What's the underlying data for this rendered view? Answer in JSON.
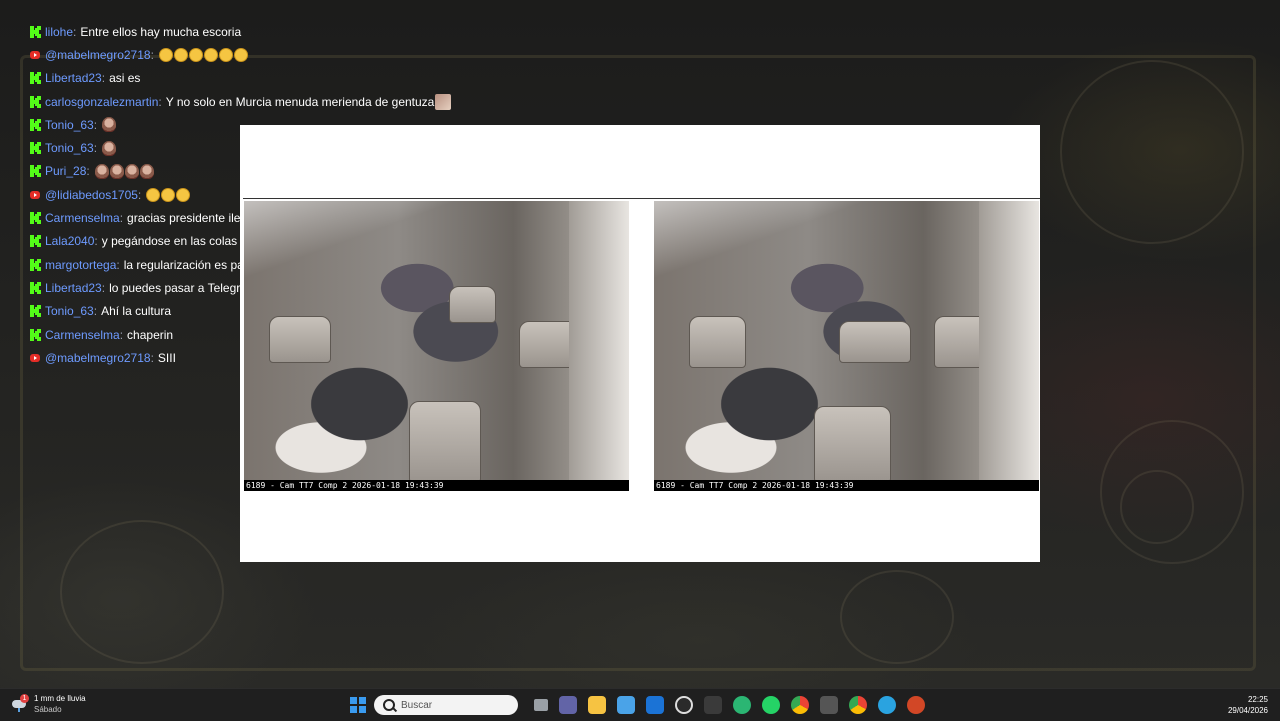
{
  "chat": [
    {
      "platform": "kick",
      "user": "lilohe",
      "text": "Entre ellos hay mucha escoria",
      "emoji": ""
    },
    {
      "platform": "youtube",
      "user": "@mabelmegro2718",
      "text": "",
      "emoji": "scream-x6"
    },
    {
      "platform": "kick",
      "user": "Libertad23",
      "text": "asi es",
      "emoji": ""
    },
    {
      "platform": "kick",
      "user": "carlosgonzalezmartin",
      "text": "Y no solo en Murcia menuda merienda de gentuza",
      "emoji": "photo"
    },
    {
      "platform": "kick",
      "user": "Tonio_63",
      "text": "",
      "emoji": "face-x1"
    },
    {
      "platform": "kick",
      "user": "Tonio_63",
      "text": "",
      "emoji": "face-x1"
    },
    {
      "platform": "kick",
      "user": "Puri_28",
      "text": "",
      "emoji": "face-x4"
    },
    {
      "platform": "youtube",
      "user": "@lidiabedos1705",
      "text": "",
      "emoji": "scream-x3"
    },
    {
      "platform": "kick",
      "user": "Carmenselma",
      "text": "gracias presidente ilegitimo y traidor",
      "emoji": ""
    },
    {
      "platform": "kick",
      "user": "Lala2040",
      "text": "y pegándose en las colas",
      "emoji": ""
    },
    {
      "platform": "kick",
      "user": "margotortega",
      "text": "la regularización es para ka ler gi. Cuando no los necesiten",
      "emoji": ""
    },
    {
      "platform": "kick",
      "user": "Libertad23",
      "text": "lo puedes pasar a Telegram Inma, el sueño de pedro",
      "emoji": ""
    },
    {
      "platform": "kick",
      "user": "Tonio_63",
      "text": "Ahí la cultura",
      "emoji": ""
    },
    {
      "platform": "kick",
      "user": "Carmenselma",
      "text": "chaperin",
      "emoji": ""
    },
    {
      "platform": "youtube",
      "user": "@mabelmegro2718",
      "text": "SIII",
      "emoji": ""
    }
  ],
  "popup": {
    "cams": [
      {
        "caption": "6189 - Cam TT7 Comp 2 2026-01-18 19:43:39"
      },
      {
        "caption": "6189 - Cam TT7 Comp 2 2026-01-18 19:43:39"
      }
    ]
  },
  "taskbar": {
    "weather_line1": "1 mm de lluvia",
    "weather_line2": "Sábado",
    "weather_alert": "1",
    "search_placeholder": "Buscar",
    "time": "22:25",
    "date": "29/04/2026",
    "apps": [
      "task-view",
      "teams",
      "file-explorer",
      "store",
      "mail",
      "camera-tool",
      "unity",
      "edge",
      "whatsapp",
      "chrome",
      "settings",
      "chrome-profile",
      "telegram",
      "powerpoint"
    ]
  },
  "colors": {
    "username": "#6e9bff",
    "kick_green": "#53fc18",
    "youtube_red": "#e52d27",
    "taskbar": "#1f1f1f"
  }
}
